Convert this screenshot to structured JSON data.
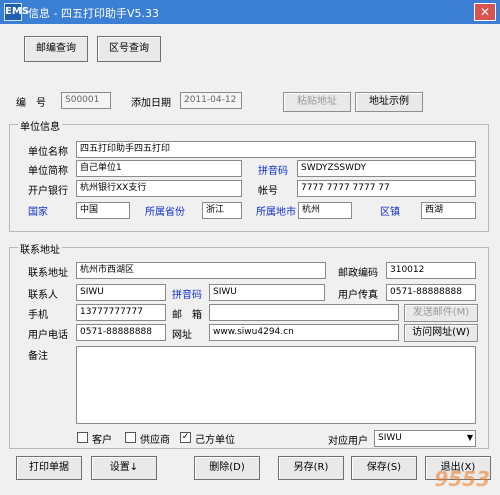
{
  "window": {
    "title": "信息 - 四五打印助手V5.33",
    "app_icon": "EMS",
    "close_icon": "✕"
  },
  "top_buttons": {
    "postcode": "邮编查询",
    "area": "区号查询"
  },
  "record": {
    "code_label": "编　号",
    "code": "S00001",
    "date_label": "添加日期",
    "date": "2011-04-12",
    "paste_label": "粘贴地址",
    "example_label": "地址示例"
  },
  "unit": {
    "group_title": "单位信息",
    "name_label": "单位名称",
    "name": "四五打印助手四五打印",
    "short_label": "单位简称",
    "short": "自己单位1",
    "pinyin_label": "拼音码",
    "pinyin": "SWDYZSSWDY",
    "bank_label": "开户银行",
    "bank": "杭州银行XX支行",
    "account_label": "帐号",
    "account": "7777 7777 7777 77",
    "country_label": "国家",
    "country": "中国",
    "province_label": "所属省份",
    "province": "浙江",
    "city_label": "所属地市",
    "city": "杭州",
    "district_label": "区镇",
    "district": "西湖"
  },
  "contact": {
    "group_title": "联系地址",
    "address_label": "联系地址",
    "address": "杭州市西湖区",
    "zip_label": "邮政编码",
    "zip": "310012",
    "person_label": "联系人",
    "person": "SIWU",
    "pinyin_label": "拼音码",
    "pinyin": "SIWU",
    "fax_label": "用户传真",
    "fax": "0571-88888888",
    "mobile_label": "手机",
    "mobile": "13777777777",
    "email_label": "邮　箱",
    "email": "",
    "send_mail_label": "发送邮件(M)",
    "phone_label": "用户电话",
    "phone": "0571-88888888",
    "website_label": "网址",
    "website": "www.siwu4294.cn",
    "visit_label": "访问网址(W)",
    "remark_label": "备注",
    "remark": "",
    "customer_label": "客户",
    "supplier_label": "供应商",
    "own_label": "己方单位",
    "own_check": "✓",
    "user_label": "对应用户",
    "user": "SIWU"
  },
  "bottom": {
    "print": "打印单据",
    "settings": "设置↓",
    "delete": "删除(D)",
    "saveas": "另存(R)",
    "save": "保存(S)",
    "exit": "退出(X)"
  },
  "watermark": "9553"
}
